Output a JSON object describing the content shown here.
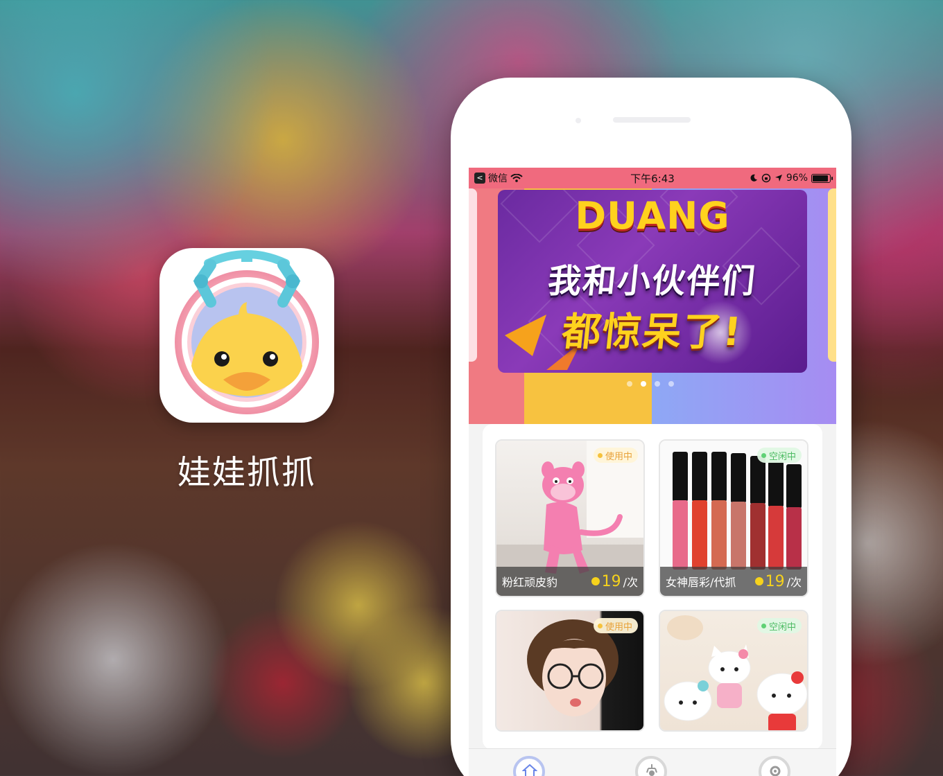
{
  "app": {
    "name": "娃娃抓抓",
    "icon_name": "duck-claw-app-icon"
  },
  "status_bar": {
    "carrier": "微信",
    "time": "下午6:43",
    "battery": "96%",
    "back_label": "<"
  },
  "banner": {
    "headline": "DUANG",
    "line1": "我和小伙伴们",
    "line2": "都惊呆了!",
    "dot_count": 4,
    "active_dot": 1
  },
  "products": [
    {
      "name": "粉红顽皮豹",
      "price": "19",
      "unit": "/次",
      "status": "使用中",
      "state": "busy",
      "image": "pink-panther-plush-image"
    },
    {
      "name": "女神唇彩/代抓",
      "price": "19",
      "unit": "/次",
      "status": "空闲中",
      "state": "idle",
      "image": "lip-gloss-image"
    },
    {
      "name": "",
      "price": "",
      "unit": "",
      "status": "使用中",
      "state": "busy",
      "image": "girl-with-glasses-image"
    },
    {
      "name": "",
      "price": "",
      "unit": "",
      "status": "空闲中",
      "state": "idle",
      "image": "hello-kitty-plush-image"
    }
  ],
  "tabs": [
    {
      "icon": "home-icon",
      "active": true
    },
    {
      "icon": "claw-machine-icon",
      "active": false
    },
    {
      "icon": "settings-gear-icon",
      "active": false
    }
  ],
  "colors": {
    "status_bar": "#f06a7e",
    "accent_yellow": "#f6d21c",
    "busy": "#e8a23a",
    "idle": "#4dbb63"
  }
}
